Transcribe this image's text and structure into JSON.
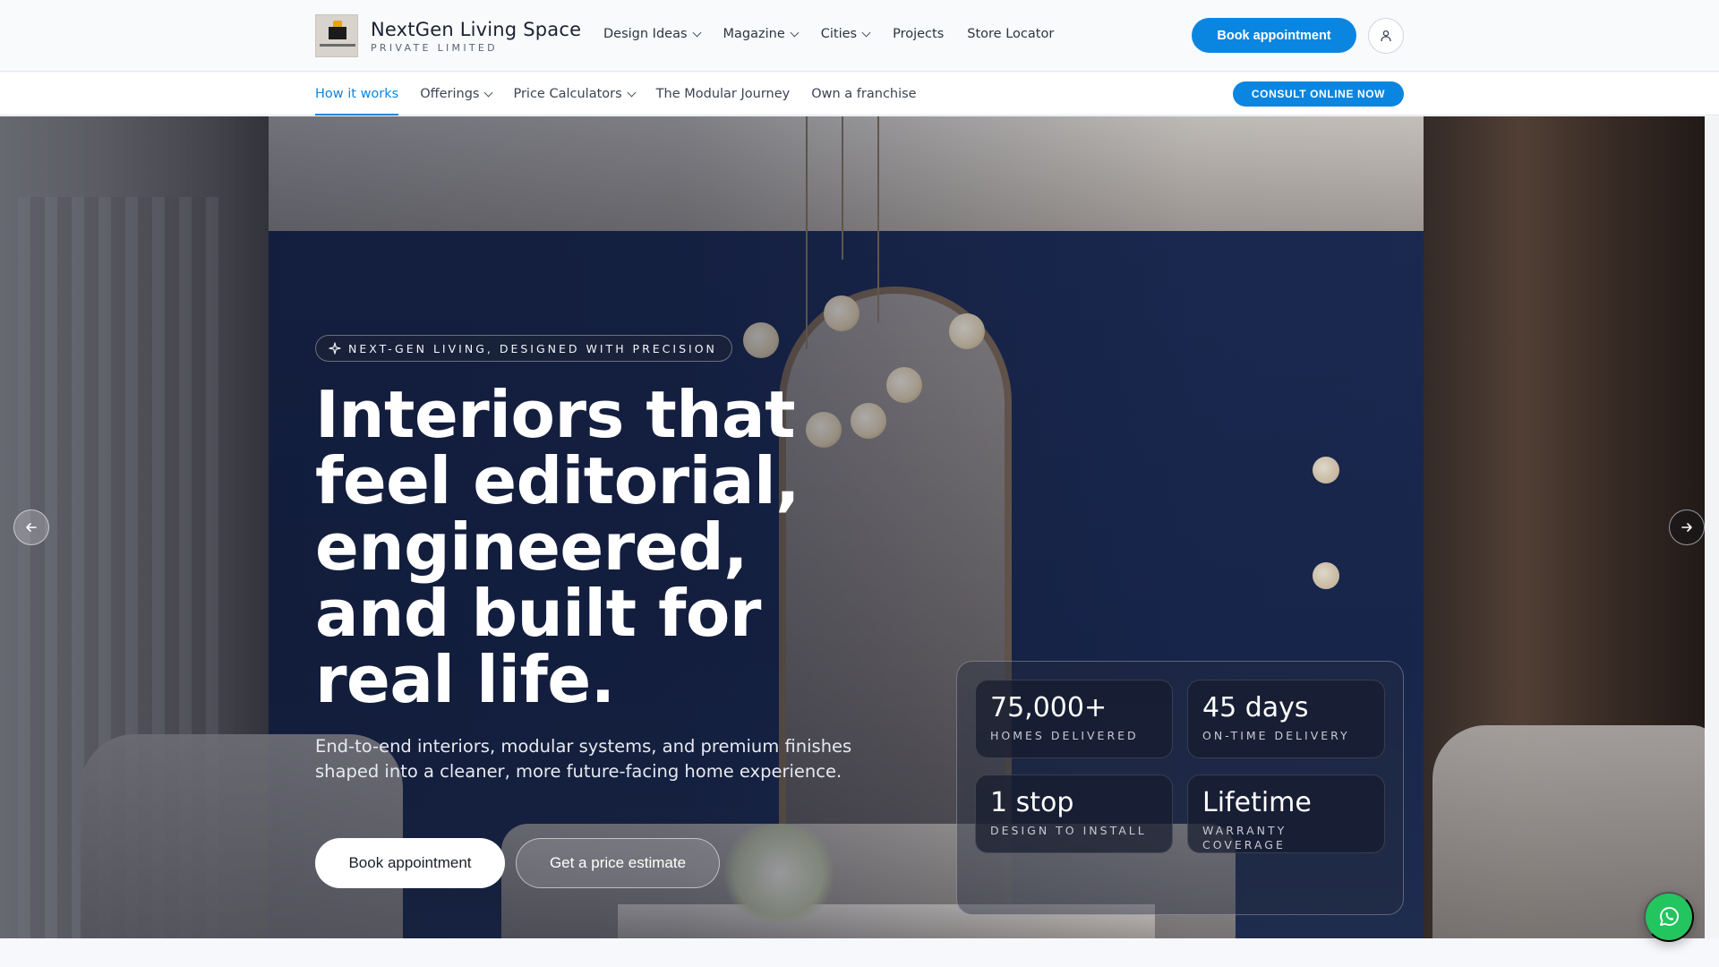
{
  "header": {
    "brand_name": "NextGen Living Space",
    "brand_sub": "PRIVATE LIMITED",
    "nav": [
      {
        "label": "Design Ideas",
        "dropdown": true
      },
      {
        "label": "Magazine",
        "dropdown": true
      },
      {
        "label": "Cities",
        "dropdown": true
      },
      {
        "label": "Projects",
        "dropdown": false
      },
      {
        "label": "Store Locator",
        "dropdown": false
      }
    ],
    "book_label": "Book appointment",
    "account_icon": "user-icon"
  },
  "subnav": {
    "items": [
      {
        "label": "How it works",
        "dropdown": false,
        "active": true
      },
      {
        "label": "Offerings",
        "dropdown": true,
        "active": false
      },
      {
        "label": "Price Calculators",
        "dropdown": true,
        "active": false
      },
      {
        "label": "The Modular Journey",
        "dropdown": false,
        "active": false
      },
      {
        "label": "Own a franchise",
        "dropdown": false,
        "active": false
      }
    ],
    "consult_label": "CONSULT ONLINE NOW"
  },
  "hero": {
    "badge": "NEXT-GEN LIVING, DESIGNED WITH PRECISION",
    "badge_icon": "sparkle-icon",
    "headline": "Interiors that feel editorial, engineered, and built for real life.",
    "subcopy": "End-to-end interiors, modular systems, and premium finishes shaped into a cleaner, more future-facing home experience.",
    "primary_cta": "Book appointment",
    "secondary_cta": "Get a price estimate",
    "stats": [
      {
        "value": "75,000+",
        "label": "HOMES DELIVERED"
      },
      {
        "value": "45 days",
        "label": "ON-TIME DELIVERY"
      },
      {
        "value": "1 stop",
        "label": "DESIGN TO INSTALL"
      },
      {
        "value": "Lifetime",
        "label": "WARRANTY COVERAGE"
      }
    ],
    "prev_icon": "arrow-left-icon",
    "next_icon": "arrow-right-icon"
  },
  "floating": {
    "whatsapp_icon": "whatsapp-icon"
  },
  "colors": {
    "accent": "#0b86e0",
    "whatsapp": "#22c55e",
    "header_bg": "#f8fafc"
  }
}
